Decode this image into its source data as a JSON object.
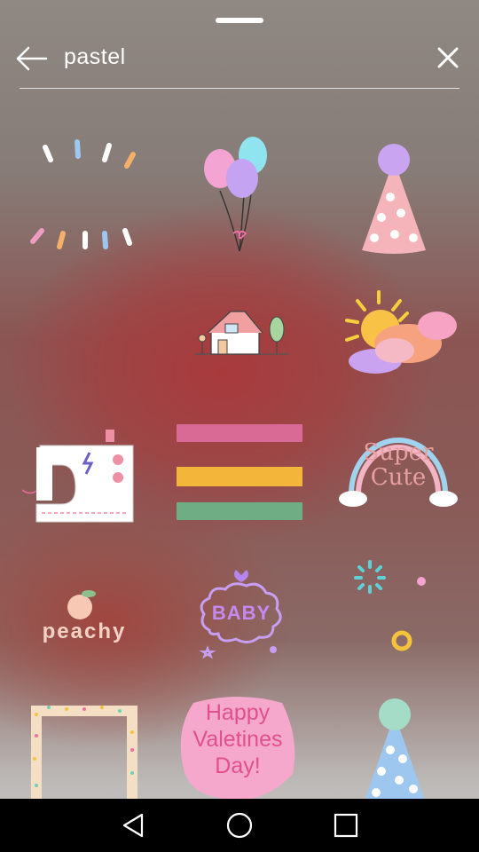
{
  "search": {
    "query": "pastel"
  },
  "stickers": [
    {
      "name": "confetti-dashes"
    },
    {
      "name": "balloons"
    },
    {
      "name": "party-hat-pink"
    },
    {
      "name": "empty"
    },
    {
      "name": "cottage"
    },
    {
      "name": "sun-clouds"
    },
    {
      "name": "sewing-machine"
    },
    {
      "name": "paint-stripes"
    },
    {
      "name": "super-cute-rainbow",
      "text_line1": "Super",
      "text_line2": "Cute"
    },
    {
      "name": "peachy",
      "text": "peachy"
    },
    {
      "name": "baby-cloud",
      "text": "BABY"
    },
    {
      "name": "dots-ring"
    },
    {
      "name": "sprinkle-frame"
    },
    {
      "name": "happy-valentines",
      "line1": "Happy",
      "line2": "Valetines",
      "line3": "Day!"
    },
    {
      "name": "party-hat-blue"
    }
  ],
  "colors": {
    "pink": "#ee8fb0",
    "yellow": "#f4b63a",
    "green": "#6fae84",
    "blue": "#9ec7ef",
    "lilac": "#c8a5f0"
  }
}
